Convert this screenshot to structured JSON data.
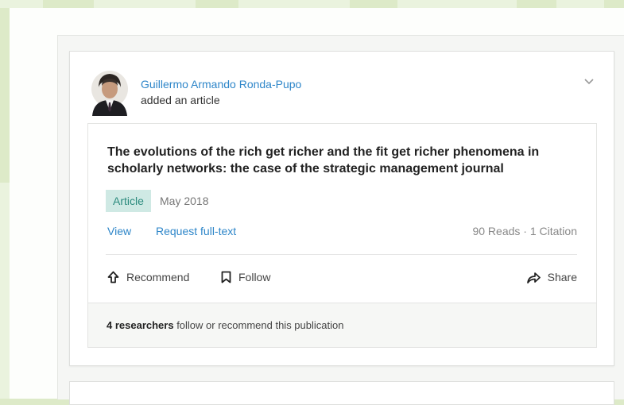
{
  "feed_item": {
    "author": {
      "name": "Guillermo Armando Ronda-Pupo",
      "action": "added an article"
    },
    "publication": {
      "title": "The evolutions of the rich get richer and the fit get richer phenomena in scholarly networks: the case of the strategic management journal",
      "type": "Article",
      "date": "May 2018",
      "links": {
        "view": "View",
        "request": "Request full-text"
      },
      "stats": "90 Reads · 1 Citation"
    },
    "actions": {
      "recommend": "Recommend",
      "follow": "Follow",
      "share": "Share"
    },
    "footer": {
      "count": "4 researchers",
      "rest": " follow or recommend this publication"
    }
  },
  "colors": {
    "link": "#2e86c9",
    "tag_bg": "#cfe9e4",
    "tag_text": "#2c8b7e",
    "page_bg": "#ddeac8"
  },
  "icons": [
    "avatar",
    "chevron-down-icon",
    "recommend-arrow-icon",
    "bookmark-icon",
    "share-arrow-icon"
  ]
}
